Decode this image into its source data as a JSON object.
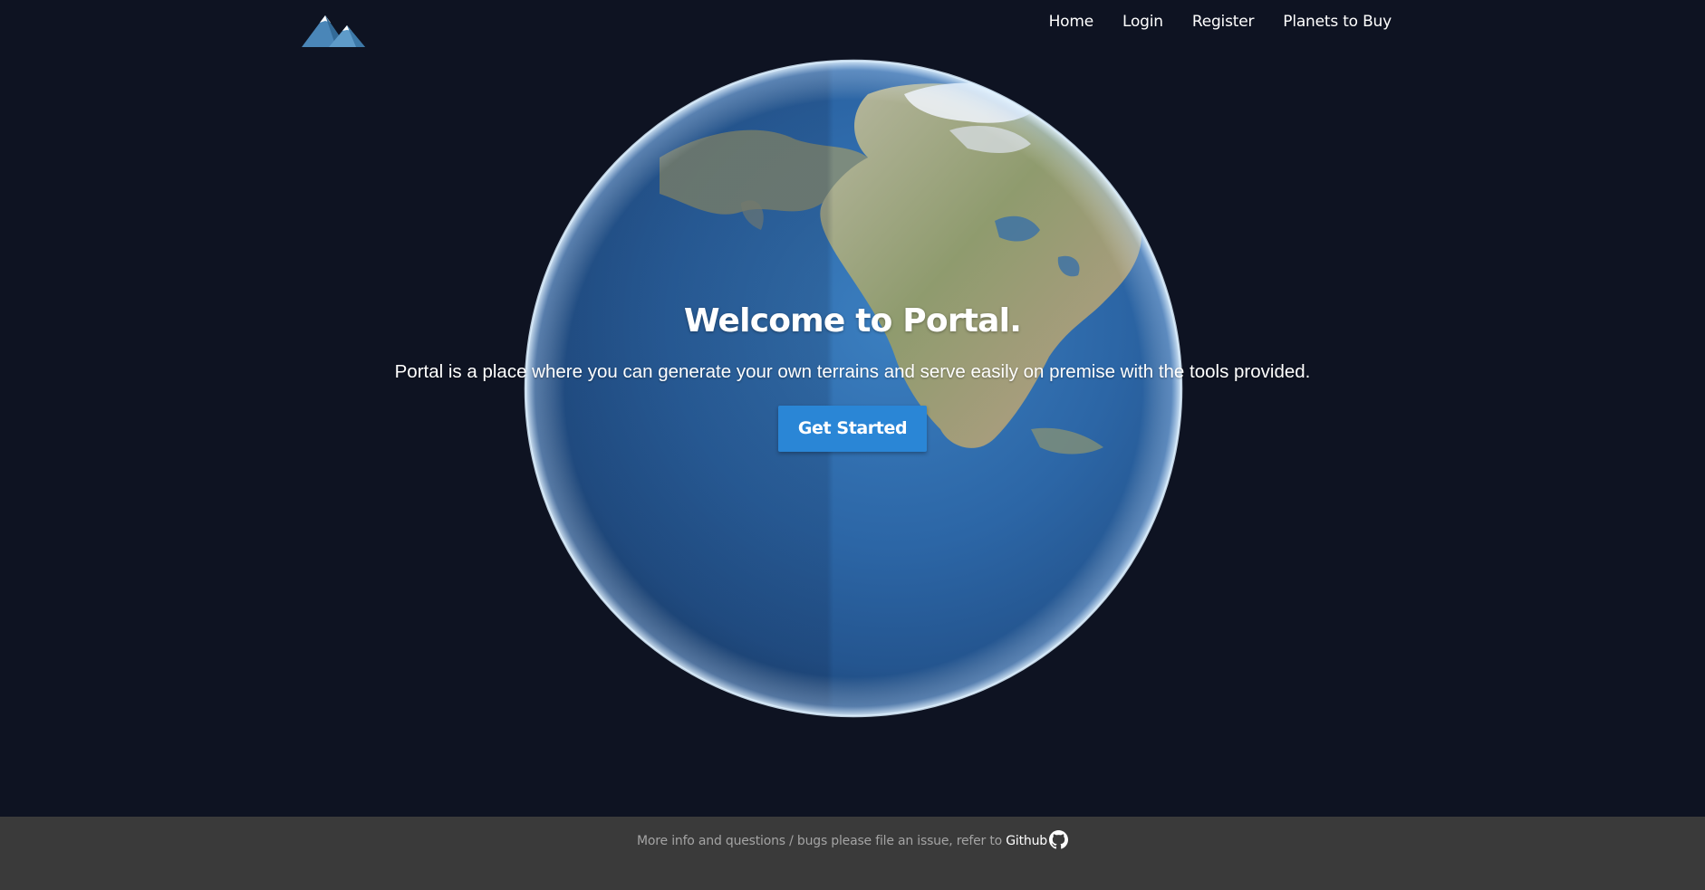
{
  "header": {
    "logo_icon": "mountain-logo-icon",
    "nav": {
      "home": "Home",
      "login": "Login",
      "register": "Register",
      "planets": "Planets to Buy"
    }
  },
  "hero": {
    "background_icon": "earth-globe-image",
    "title": "Welcome to Portal.",
    "subtitle": "Portal is a place where you can generate your own terrains and serve easily on premise with the tools provided.",
    "cta_label": "Get Started"
  },
  "footer": {
    "text": "More info and questions / bugs please file an issue, refer to ",
    "link_label": "Github",
    "link_icon": "github-icon"
  },
  "colors": {
    "background": "#0e1322",
    "accent": "#2a86d6",
    "footer_bg": "#3a3a3a"
  }
}
